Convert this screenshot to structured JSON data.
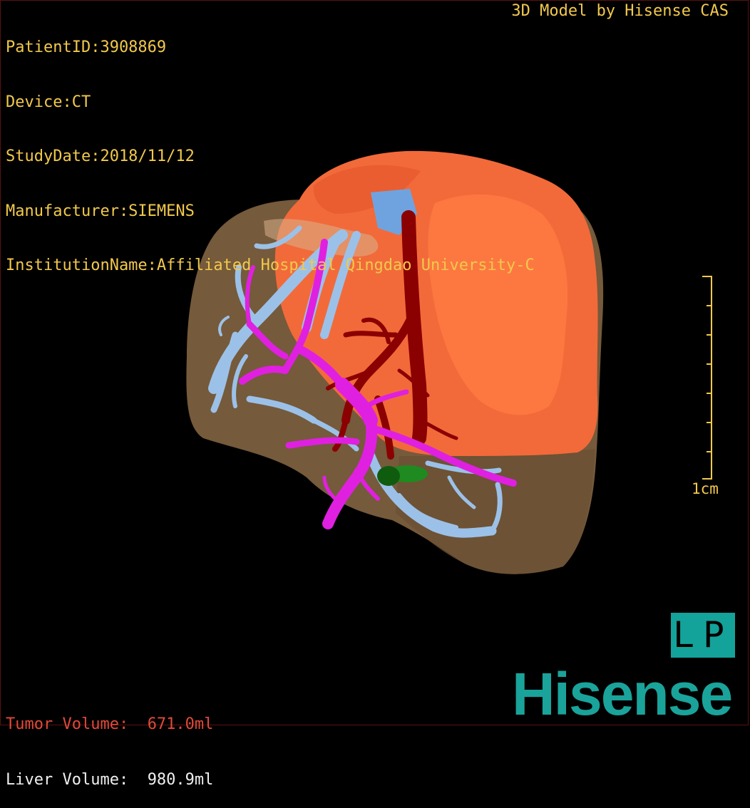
{
  "study_info": {
    "patient_id": "PatientID:3908869",
    "device": "Device:CT",
    "study_date": "StudyDate:2018/11/12",
    "manufacturer": "Manufacturer:SIEMENS",
    "institution": "InstitutionName:Affiliated Hospital Qingdao University-C"
  },
  "credit": "3D Model by Hisense CAS",
  "scale": {
    "label": "1cm"
  },
  "orientation": "LP",
  "volumes": {
    "tumor": {
      "label": "Tumor Volume:",
      "value": "671.0ml"
    },
    "liver": {
      "label": "Liver Volume:",
      "value": "980.9ml"
    }
  },
  "logo": "Hisense",
  "colors": {
    "overlay_text": "#f2c94c",
    "tumor_text": "#e04a3a",
    "liver": "#8a6a45",
    "tumor": "#f26a3a",
    "portal_vein": "#9cc1e8",
    "hepatic_artery": "#8b0000",
    "bile_duct": "#e020e0",
    "gallbladder": "#1f8a1f",
    "brand": "#1aa39a"
  }
}
